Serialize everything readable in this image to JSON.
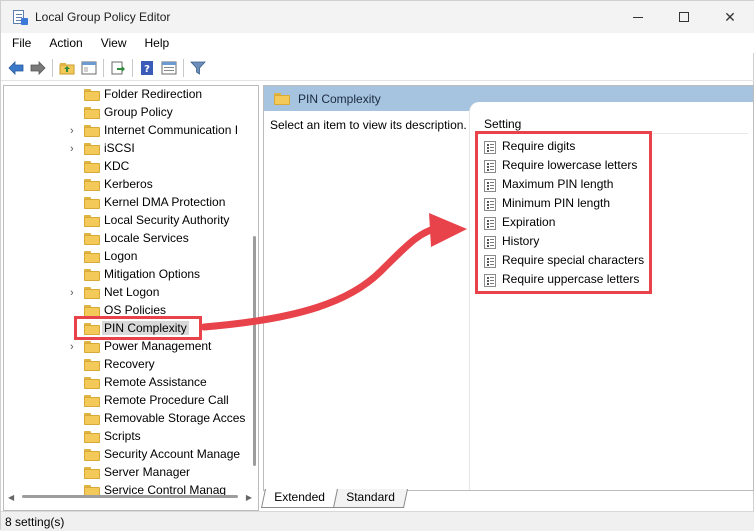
{
  "window": {
    "title": "Local Group Policy Editor",
    "minimize_glyph": "–",
    "maximize_glyph": "□",
    "close_glyph": "✕"
  },
  "menu": {
    "items": [
      {
        "label": "File"
      },
      {
        "label": "Action"
      },
      {
        "label": "View"
      },
      {
        "label": "Help"
      }
    ]
  },
  "toolbar": {
    "buttons": [
      "back-icon",
      "forward-icon",
      "up-folder-icon",
      "show-hide-tree-icon",
      "export-list-icon",
      "help-icon",
      "properties-icon",
      "filter-icon"
    ]
  },
  "tree": {
    "items": [
      {
        "label": "Folder Redirection",
        "expandable": false
      },
      {
        "label": "Group Policy",
        "expandable": false
      },
      {
        "label": "Internet Communication I",
        "expandable": true
      },
      {
        "label": "iSCSI",
        "expandable": true
      },
      {
        "label": "KDC",
        "expandable": false
      },
      {
        "label": "Kerberos",
        "expandable": false
      },
      {
        "label": "Kernel DMA Protection",
        "expandable": false
      },
      {
        "label": "Local Security Authority",
        "expandable": false
      },
      {
        "label": "Locale Services",
        "expandable": false
      },
      {
        "label": "Logon",
        "expandable": false
      },
      {
        "label": "Mitigation Options",
        "expandable": false
      },
      {
        "label": "Net Logon",
        "expandable": true
      },
      {
        "label": "OS Policies",
        "expandable": false
      },
      {
        "label": "PIN Complexity",
        "expandable": false,
        "selected": true
      },
      {
        "label": "Power Management",
        "expandable": true
      },
      {
        "label": "Recovery",
        "expandable": false
      },
      {
        "label": "Remote Assistance",
        "expandable": false
      },
      {
        "label": "Remote Procedure Call",
        "expandable": false
      },
      {
        "label": "Removable Storage Acces",
        "expandable": false
      },
      {
        "label": "Scripts",
        "expandable": false
      },
      {
        "label": "Security Account Manage",
        "expandable": false
      },
      {
        "label": "Server Manager",
        "expandable": false
      },
      {
        "label": "Service Control Manag",
        "expandable": false
      }
    ]
  },
  "right": {
    "header_title": "PIN Complexity",
    "description": "Select an item to view its description.",
    "column_header": "Setting",
    "settings": [
      {
        "label": "Require digits"
      },
      {
        "label": "Require lowercase letters"
      },
      {
        "label": "Maximum PIN length"
      },
      {
        "label": "Minimum PIN length"
      },
      {
        "label": "Expiration"
      },
      {
        "label": "History"
      },
      {
        "label": "Require special characters"
      },
      {
        "label": "Require uppercase letters"
      }
    ]
  },
  "tabs": [
    {
      "label": "Extended",
      "active": true
    },
    {
      "label": "Standard",
      "active": false
    }
  ],
  "status": {
    "text": "8 setting(s)"
  },
  "colors": {
    "highlight": "#e8434a",
    "header_blue": "#a6c3e0",
    "folder": "#f3ca59"
  }
}
